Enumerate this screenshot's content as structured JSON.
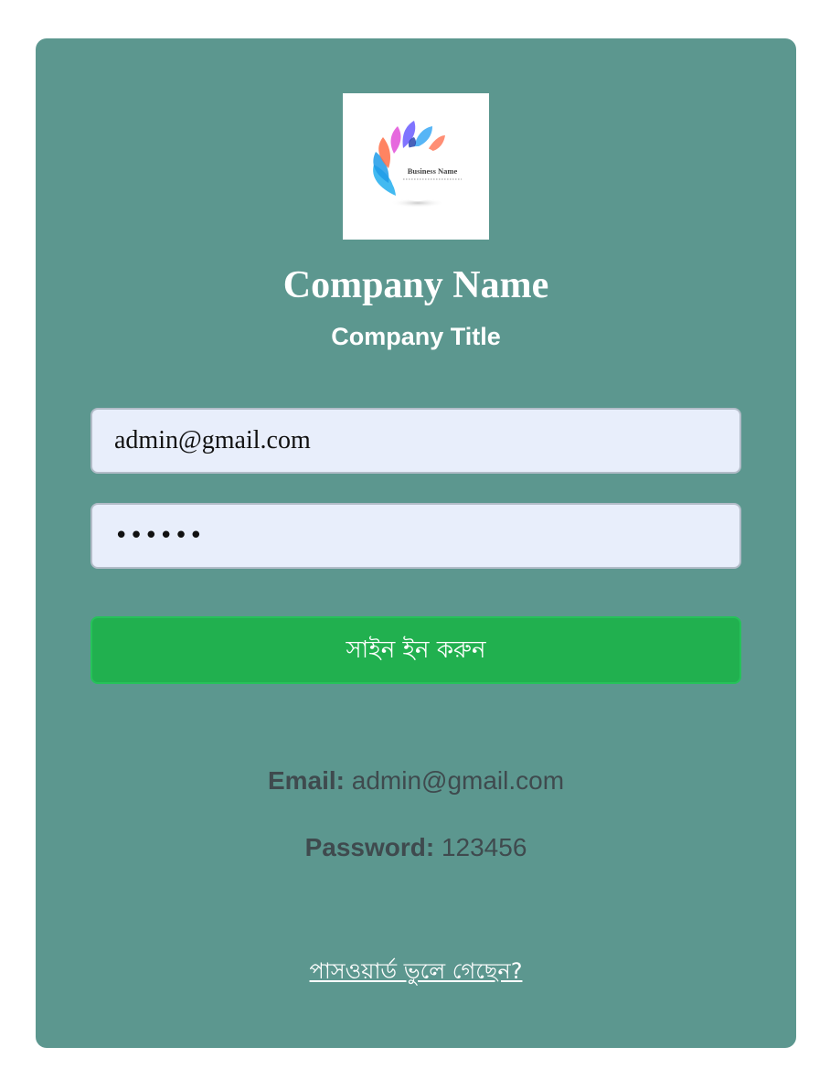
{
  "logo": {
    "text": "Business Name",
    "icon": "lotus-petals-logo-icon",
    "colors": [
      "#3aa8f5",
      "#6a5cff",
      "#e84fd6",
      "#ff7a45",
      "#1a3aa8",
      "#ff5e7e"
    ]
  },
  "header": {
    "company_name": "Company Name",
    "company_title": "Company Title"
  },
  "form": {
    "email_value": "admin@gmail.com",
    "password_value": "123456",
    "signin_label": "সাইন ইন করুন"
  },
  "credentials": {
    "email_label": "Email:",
    "email_value": "admin@gmail.com",
    "password_label": "Password:",
    "password_value": "123456"
  },
  "forgot_label": "পাসওয়ার্ড ভুলে গেছেন?",
  "colors": {
    "card_bg": "#5c978f",
    "button_bg": "#21b04f",
    "input_bg": "#e8eefb"
  }
}
